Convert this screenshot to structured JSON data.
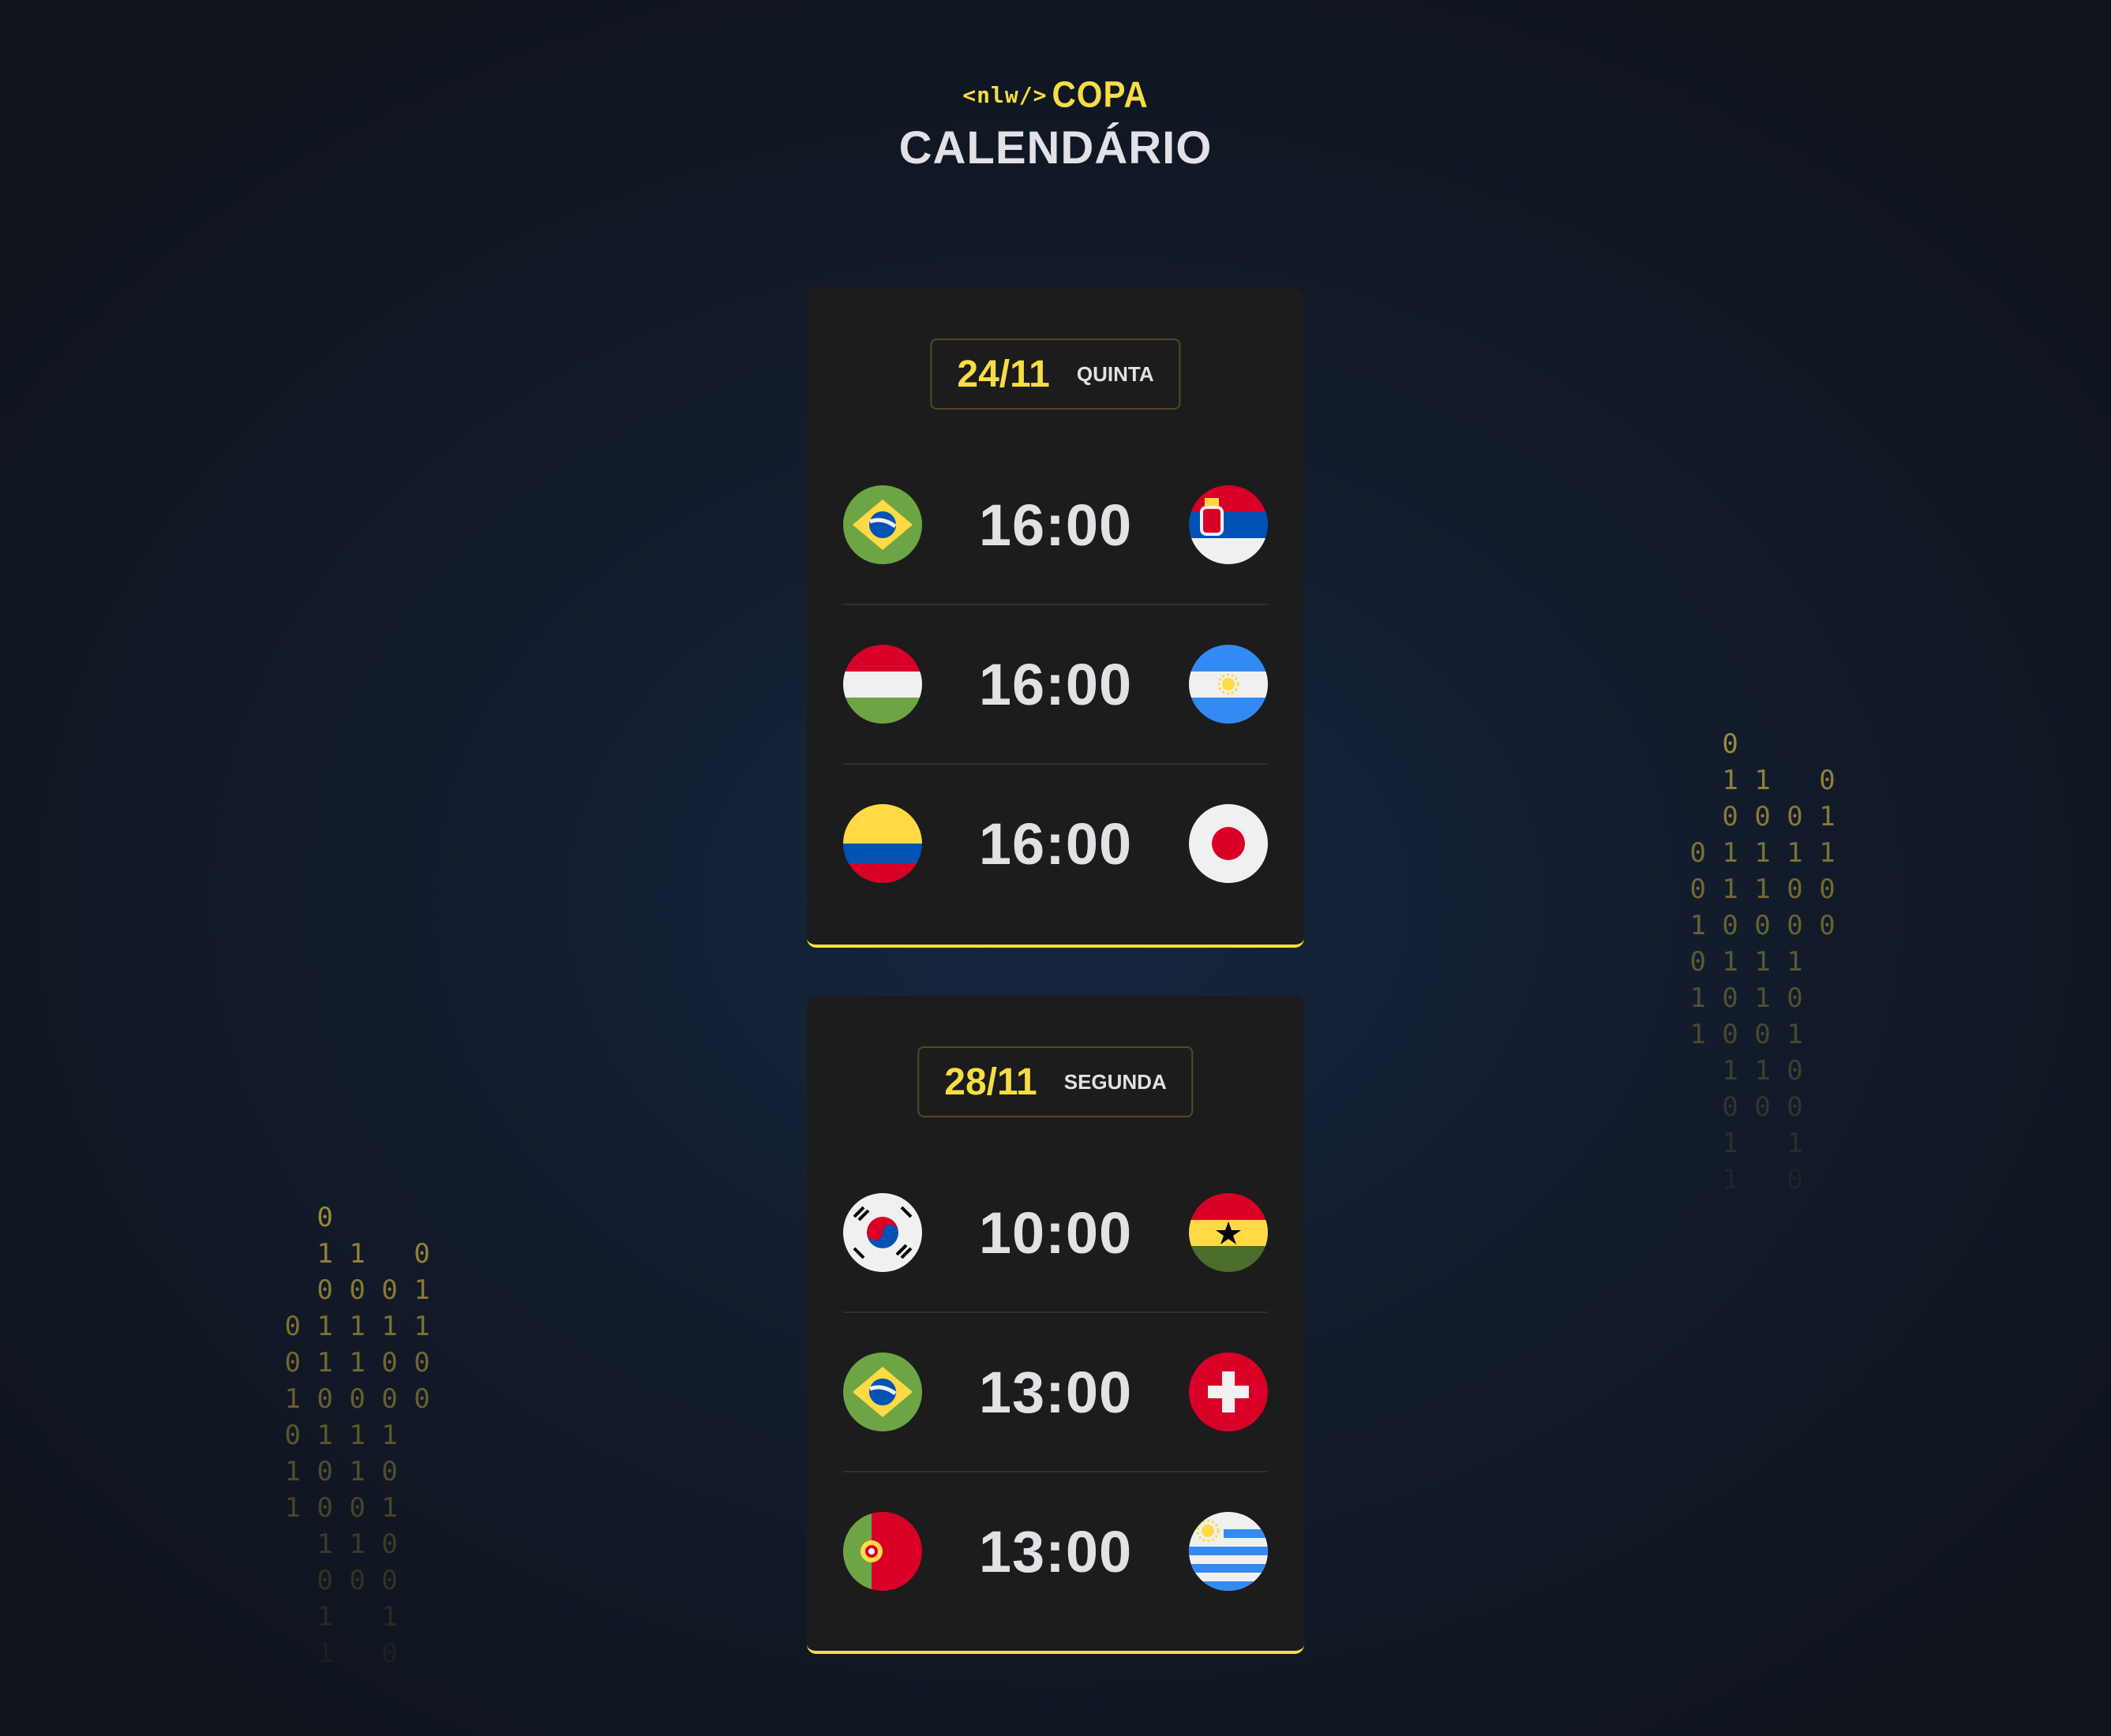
{
  "header": {
    "logo_small": "<nlw/>",
    "logo_big": "COPA",
    "title": "CALENDÁRIO"
  },
  "days": [
    {
      "date": "24/11",
      "weekday": "QUINTA",
      "games": [
        {
          "home": "brazil",
          "hour": "16:00",
          "away": "serbia"
        },
        {
          "home": "hungary",
          "hour": "16:00",
          "away": "argentina"
        },
        {
          "home": "colombia",
          "hour": "16:00",
          "away": "japan"
        }
      ]
    },
    {
      "date": "28/11",
      "weekday": "SEGUNDA",
      "games": [
        {
          "home": "south-korea",
          "hour": "10:00",
          "away": "ghana"
        },
        {
          "home": "brazil",
          "hour": "13:00",
          "away": "switzerland"
        },
        {
          "home": "portugal",
          "hour": "13:00",
          "away": "uruguay"
        }
      ]
    }
  ],
  "binary_rain": {
    "right": [
      "   0",
      "   1 1   0",
      "   0 0 0 1",
      " 0 1 1 1 1",
      " 0 1 1 0 0",
      " 1 0 0 0 0",
      " 0 1 1 1",
      " 1 0 1 0",
      " 1 0 0 1",
      "   1 1 0",
      "   0 0 0",
      "   1   1",
      "   1   0"
    ],
    "left": [
      "   0",
      "   1 1   0",
      "   0 0 0 1",
      " 0 1 1 1 1",
      " 0 1 1 0 0",
      " 1 0 0 0 0",
      " 0 1 1 1",
      " 1 0 1 0",
      " 1 0 0 1",
      "   1 1 0",
      "   0 0 0",
      "   1   1",
      "   1   0"
    ]
  },
  "colors": {
    "accent": "#f7dd43",
    "card": "#1c1c1c",
    "text": "#e1e1e6"
  }
}
